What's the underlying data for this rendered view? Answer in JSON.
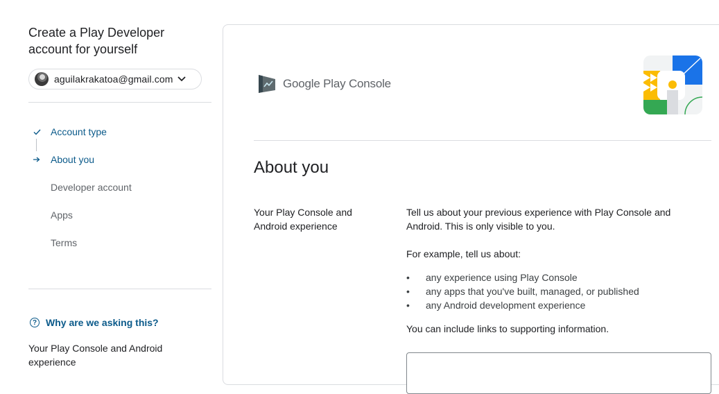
{
  "sidebar": {
    "title": "Create a Play Developer account for yourself",
    "account_email": "aguilakrakatoa@gmail.com",
    "steps": [
      {
        "label": "Account type",
        "state": "done",
        "icon": "check-icon"
      },
      {
        "label": "About you",
        "state": "current",
        "icon": "arrow-right-icon"
      },
      {
        "label": "Developer account",
        "state": "todo"
      },
      {
        "label": "Apps",
        "state": "todo"
      },
      {
        "label": "Terms",
        "state": "todo"
      }
    ],
    "why_label": "Why are we asking this?",
    "why_text": "Your Play Console and Android experience"
  },
  "main": {
    "logo_google_play": "Google Play",
    "logo_console": "Console",
    "page_title": "About you",
    "field_label": "Your Play Console and Android experience",
    "description_1": "Tell us about your previous experience with Play Console and Android. This is only visible to you.",
    "description_2": "For example, tell us about:",
    "bullets": [
      "any experience using Play Console",
      "any apps that you've built, managed, or published",
      "any Android development experience"
    ],
    "description_3": "You can include links to supporting information.",
    "textarea_value": ""
  },
  "colors": {
    "accent": "#0b5a8a",
    "divider": "#dadce0",
    "text": "#202124",
    "muted": "#5f6368"
  }
}
